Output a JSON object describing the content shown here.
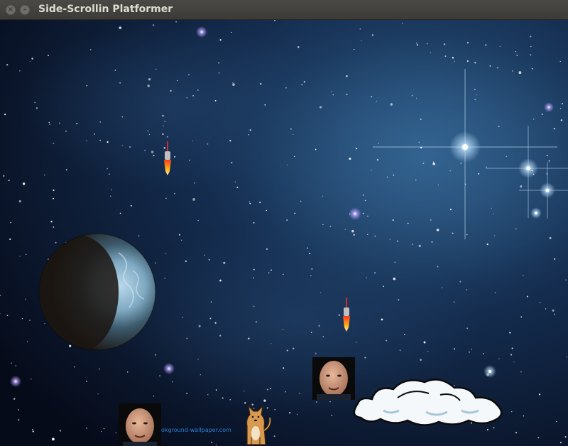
{
  "window": {
    "title": "Side-Scrollin Platformer"
  },
  "background": {
    "watermark_text": "okground-wallpaper.com"
  },
  "sprites": {
    "enemy_face_count": 2,
    "missile_count": 2
  },
  "icons": {
    "close": "close-icon",
    "minimize": "minimize-icon"
  }
}
